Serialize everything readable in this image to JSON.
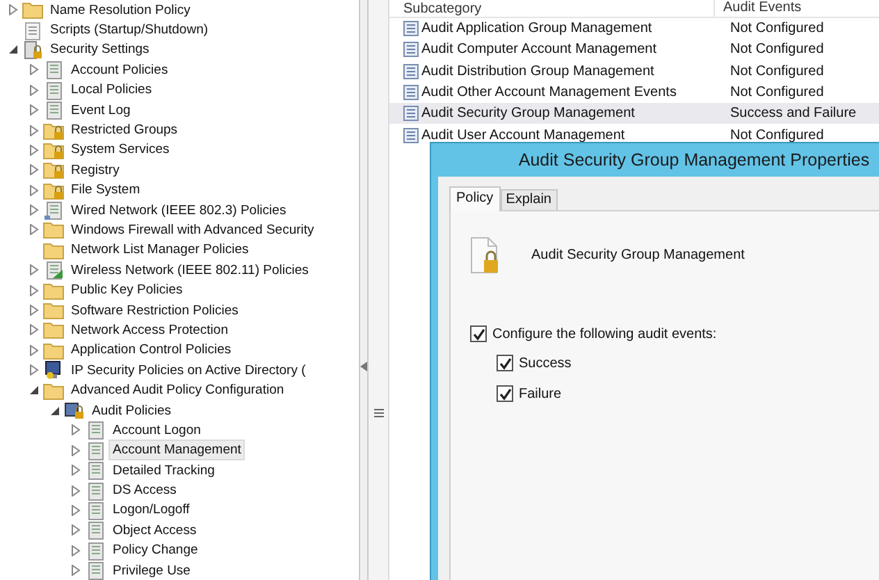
{
  "tree": [
    {
      "label": "Name Resolution Policy",
      "kind": "folder",
      "expandable": true,
      "expanded": false,
      "selected": false
    },
    {
      "label": "Scripts (Startup/Shutdown)",
      "kind": "script",
      "expandable": false,
      "selected": false
    },
    {
      "label": "Security Settings",
      "kind": "secure",
      "expandable": true,
      "expanded": true,
      "selected": false,
      "children": [
        {
          "label": "Account Policies",
          "kind": "policy",
          "expandable": true,
          "expanded": false,
          "selected": false
        },
        {
          "label": "Local Policies",
          "kind": "policy",
          "expandable": true,
          "expanded": false,
          "selected": false
        },
        {
          "label": "Event Log",
          "kind": "policy",
          "expandable": true,
          "expanded": false,
          "selected": false
        },
        {
          "label": "Restricted Groups",
          "kind": "locked-folder",
          "expandable": true,
          "expanded": false,
          "selected": false
        },
        {
          "label": "System Services",
          "kind": "locked-folder",
          "expandable": true,
          "expanded": false,
          "selected": false
        },
        {
          "label": "Registry",
          "kind": "locked-folder",
          "expandable": true,
          "expanded": false,
          "selected": false
        },
        {
          "label": "File System",
          "kind": "locked-folder",
          "expandable": true,
          "expanded": false,
          "selected": false
        },
        {
          "label": "Wired Network (IEEE 802.3) Policies",
          "kind": "network",
          "expandable": true,
          "expanded": false,
          "selected": false
        },
        {
          "label": "Windows Firewall with Advanced Security",
          "kind": "folder",
          "expandable": true,
          "expanded": false,
          "selected": false
        },
        {
          "label": "Network List Manager Policies",
          "kind": "folder",
          "expandable": false,
          "selected": false
        },
        {
          "label": "Wireless Network (IEEE 802.11) Policies",
          "kind": "wireless",
          "expandable": true,
          "expanded": false,
          "selected": false
        },
        {
          "label": "Public Key Policies",
          "kind": "folder",
          "expandable": true,
          "expanded": false,
          "selected": false
        },
        {
          "label": "Software Restriction Policies",
          "kind": "folder",
          "expandable": true,
          "expanded": false,
          "selected": false
        },
        {
          "label": "Network Access Protection",
          "kind": "folder",
          "expandable": true,
          "expanded": false,
          "selected": false
        },
        {
          "label": "Application Control Policies",
          "kind": "folder",
          "expandable": true,
          "expanded": false,
          "selected": false
        },
        {
          "label": "IP Security Policies on Active Directory (",
          "kind": "ipsec",
          "expandable": true,
          "expanded": false,
          "selected": false
        },
        {
          "label": "Advanced Audit Policy Configuration",
          "kind": "folder",
          "expandable": true,
          "expanded": true,
          "selected": false,
          "children": [
            {
              "label": "Audit Policies",
              "kind": "audit",
              "expandable": true,
              "expanded": true,
              "selected": false,
              "children": [
                {
                  "label": "Account Logon",
                  "kind": "policy",
                  "expandable": true,
                  "expanded": false,
                  "selected": false
                },
                {
                  "label": "Account Management",
                  "kind": "policy",
                  "expandable": true,
                  "expanded": false,
                  "selected": true
                },
                {
                  "label": "Detailed Tracking",
                  "kind": "policy",
                  "expandable": true,
                  "expanded": false,
                  "selected": false
                },
                {
                  "label": "DS Access",
                  "kind": "policy",
                  "expandable": true,
                  "expanded": false,
                  "selected": false
                },
                {
                  "label": "Logon/Logoff",
                  "kind": "policy",
                  "expandable": true,
                  "expanded": false,
                  "selected": false
                },
                {
                  "label": "Object Access",
                  "kind": "policy",
                  "expandable": true,
                  "expanded": false,
                  "selected": false
                },
                {
                  "label": "Policy Change",
                  "kind": "policy",
                  "expandable": true,
                  "expanded": false,
                  "selected": false
                },
                {
                  "label": "Privilege Use",
                  "kind": "policy",
                  "expandable": true,
                  "expanded": false,
                  "selected": false
                }
              ]
            }
          ]
        }
      ]
    }
  ],
  "table": {
    "columns": [
      "Subcategory",
      "Audit Events"
    ],
    "rows": [
      {
        "subcategory": "Audit Application Group Management",
        "audit_events": "Not Configured",
        "selected": false
      },
      {
        "subcategory": "Audit Computer Account Management",
        "audit_events": "Not Configured",
        "selected": false
      },
      {
        "subcategory": "Audit Distribution Group Management",
        "audit_events": "Not Configured",
        "selected": false
      },
      {
        "subcategory": "Audit Other Account Management Events",
        "audit_events": "Not Configured",
        "selected": false
      },
      {
        "subcategory": "Audit Security Group Management",
        "audit_events": "Success and Failure",
        "selected": true
      },
      {
        "subcategory": "Audit User Account Management",
        "audit_events": "Not Configured",
        "selected": false
      }
    ]
  },
  "dialog": {
    "title": "Audit Security Group Management Properties",
    "tabs": [
      {
        "label": "Policy",
        "selected": true
      },
      {
        "label": "Explain",
        "selected": false
      }
    ],
    "policy_name": "Audit Security Group Management",
    "configure": {
      "label": "Configure the following audit events:",
      "checked": true
    },
    "options": [
      {
        "label": "Success",
        "checked": true
      },
      {
        "label": "Failure",
        "checked": true
      }
    ]
  }
}
